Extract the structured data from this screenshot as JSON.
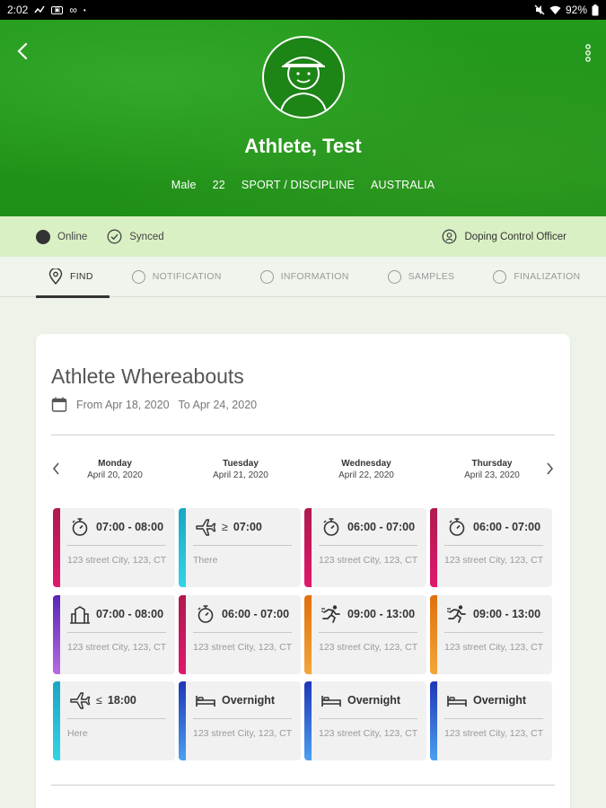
{
  "status_bar": {
    "time": "2:02",
    "battery": "92%",
    "icons": [
      "signal-icon",
      "box-icon",
      "infinity-icon",
      "dot-icon",
      "mute-icon",
      "wifi-icon",
      "battery-icon"
    ]
  },
  "header": {
    "name": "Athlete, Test",
    "gender": "Male",
    "age": "22",
    "sport": "SPORT / DISCIPLINE",
    "country": "AUSTRALIA",
    "back_icon": "back-arrow-icon",
    "more_icon": "more-vert-icon",
    "avatar_icon": "athlete-avatar-icon"
  },
  "strip": {
    "online": "Online",
    "synced": "Synced",
    "role": "Doping Control Officer"
  },
  "steps": [
    "FIND",
    "NOTIFICATION",
    "INFORMATION",
    "SAMPLES",
    "FINALIZATION"
  ],
  "card": {
    "title": "Athlete Whereabouts",
    "from": "From Apr 18, 2020",
    "to": "To Apr 24, 2020"
  },
  "days": [
    {
      "name": "Monday",
      "date": "April 20, 2020"
    },
    {
      "name": "Tuesday",
      "date": "April 21, 2020"
    },
    {
      "name": "Wednesday",
      "date": "April 22, 2020"
    },
    {
      "name": "Thursday",
      "date": "April 23, 2020"
    }
  ],
  "slots": [
    [
      {
        "time": "07:00 - 08:00",
        "address": "123 street City, 123, CT",
        "icon": "stopwatch-icon",
        "color": "#d0185f"
      },
      {
        "time": "07:00 - 08:00",
        "address": "123 street City, 123, CT",
        "icon": "building-icon",
        "color": "#8a45d0"
      },
      {
        "time": "18:00",
        "address": "Here",
        "icon": "plane-arrival-icon",
        "color": "#22b8d6"
      }
    ],
    [
      {
        "time": "07:00",
        "address": "There",
        "icon": "plane-departure-icon",
        "color": "#22b8d6"
      },
      {
        "time": "06:00 - 07:00",
        "address": "123 street City, 123, CT",
        "icon": "stopwatch-icon",
        "color": "#d0185f"
      },
      {
        "time": "Overnight",
        "address": "123 street City, 123, CT",
        "icon": "bed-icon",
        "color": "#2c5ad0"
      }
    ],
    [
      {
        "time": "06:00 - 07:00",
        "address": "123 street City, 123, CT",
        "icon": "stopwatch-icon",
        "color": "#d0185f"
      },
      {
        "time": "09:00 - 13:00",
        "address": "123 street City, 123, CT",
        "icon": "runner-icon",
        "color": "#ea8a22"
      },
      {
        "time": "Overnight",
        "address": "123 street City, 123, CT",
        "icon": "bed-icon",
        "color": "#2c5ad0"
      }
    ],
    [
      {
        "time": "06:00 - 07:00",
        "address": "123 street City, 123, CT",
        "icon": "stopwatch-icon",
        "color": "#d0185f"
      },
      {
        "time": "09:00 - 13:00",
        "address": "123 street City, 123, CT",
        "icon": "runner-icon",
        "color": "#ea8a22"
      },
      {
        "time": "Overnight",
        "address": "123 street City, 123, CT",
        "icon": "bed-icon",
        "color": "#2c5ad0"
      }
    ]
  ]
}
